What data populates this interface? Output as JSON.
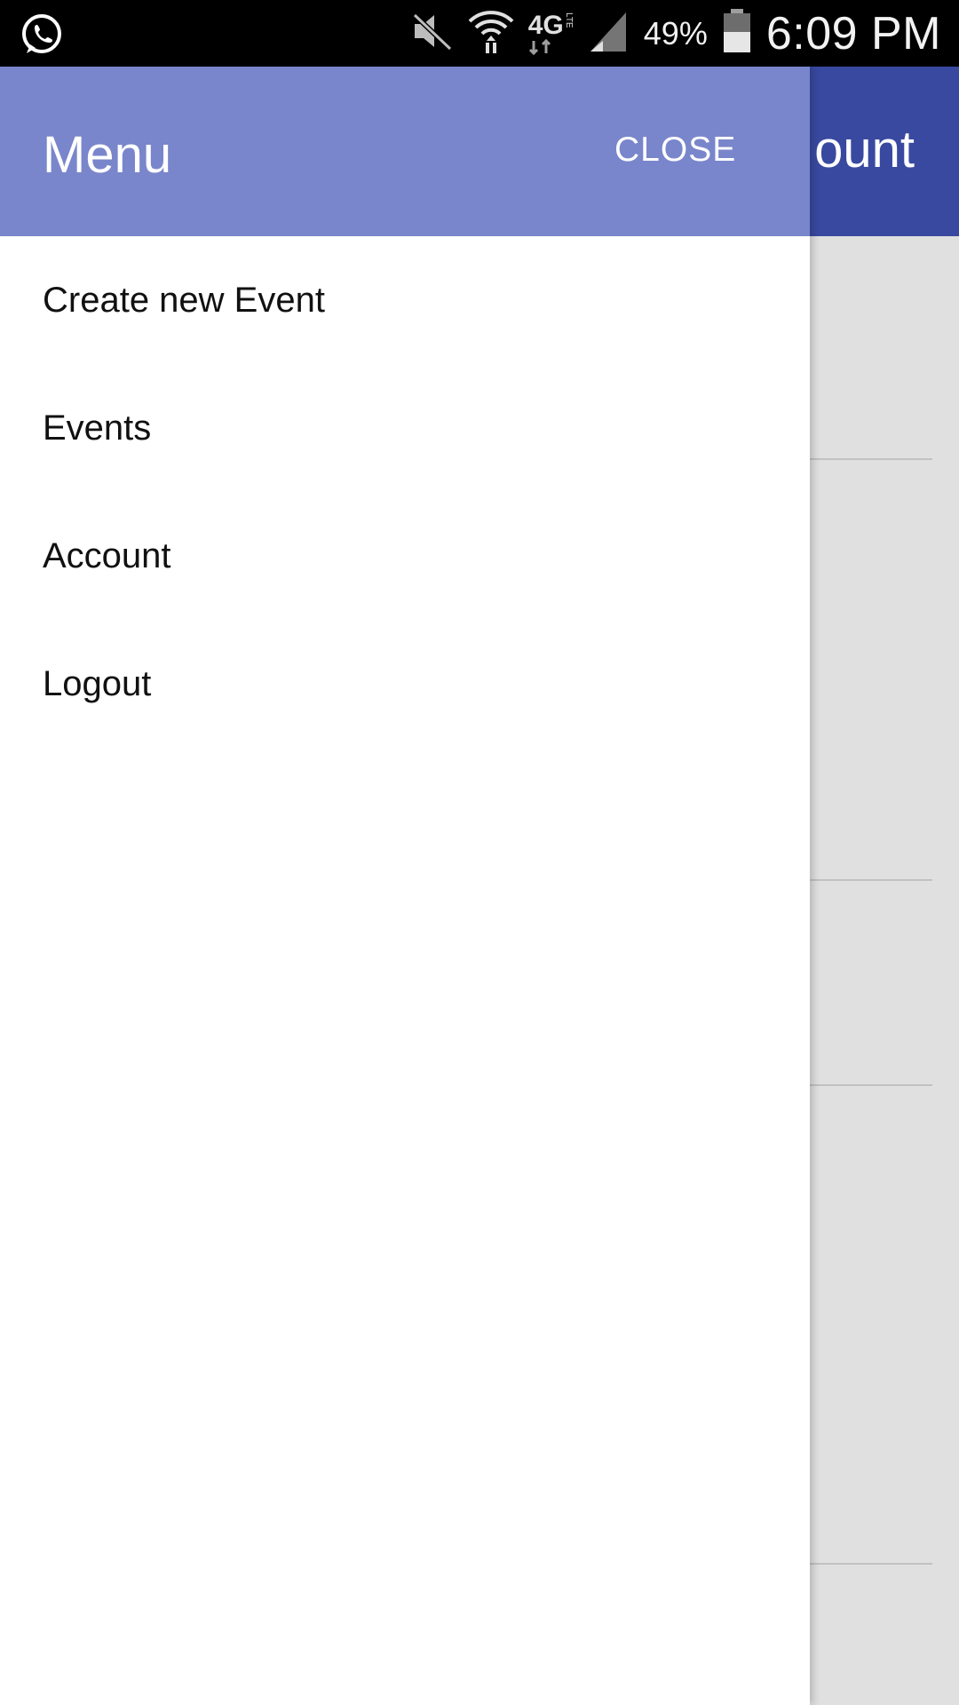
{
  "status_bar": {
    "battery": "49%",
    "time": "6:09 PM",
    "network": "4G",
    "network_sub": "LTE",
    "icons": [
      "whatsapp-icon",
      "mute-icon",
      "wifi-icon",
      "lte-icon",
      "signal-icon",
      "battery-icon"
    ]
  },
  "background": {
    "toolbar_title": "ount",
    "toolbar_color": "#3949a0"
  },
  "drawer": {
    "title": "Menu",
    "close_label": "CLOSE",
    "header_color": "#7986cb",
    "items": [
      {
        "label": "Create new Event"
      },
      {
        "label": "Events"
      },
      {
        "label": "Account"
      },
      {
        "label": "Logout"
      }
    ]
  }
}
